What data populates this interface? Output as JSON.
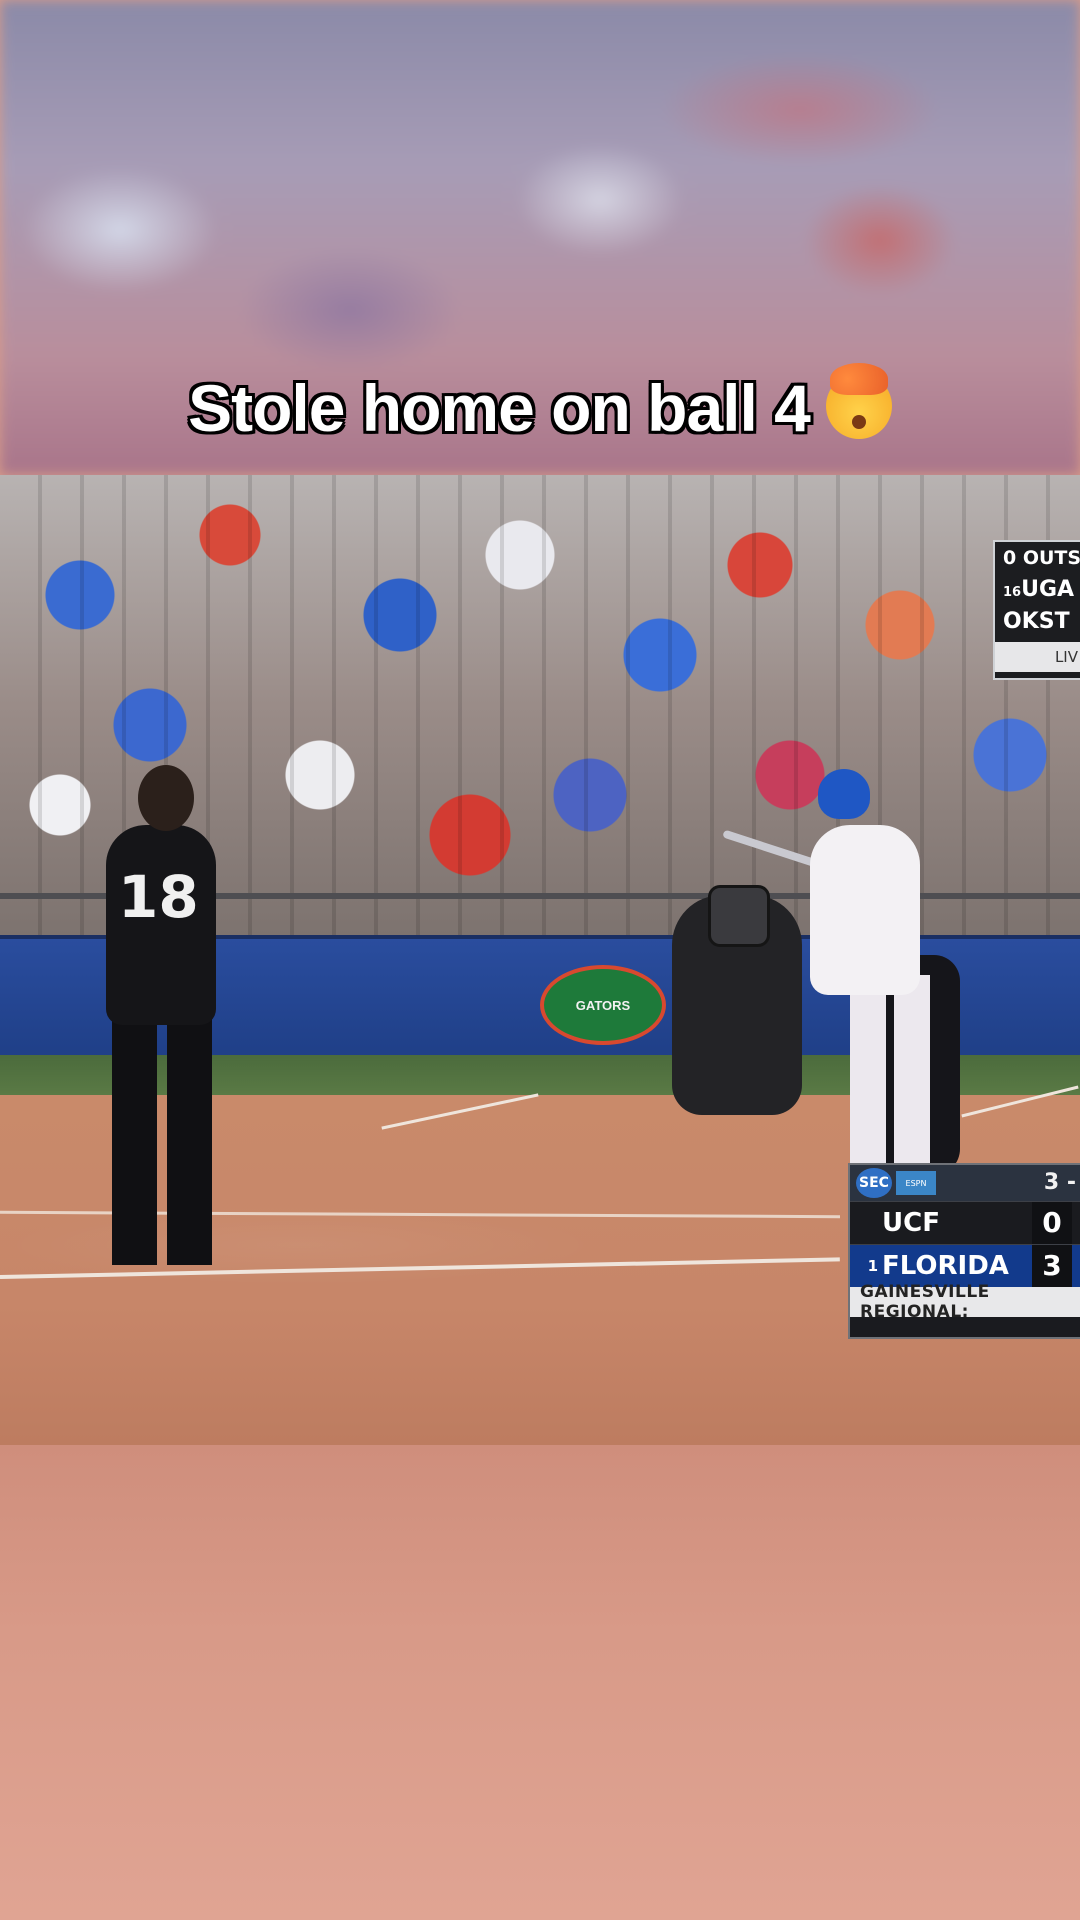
{
  "caption": {
    "text": "Stole home on ball 4",
    "emoji": "exploding-head-emoji"
  },
  "scoreboard": {
    "network_logo": "SEC",
    "network_badge": "ESPN",
    "inning": "3 -",
    "teams": [
      {
        "seed": "",
        "name": "UCF",
        "score": "0"
      },
      {
        "seed": "1",
        "name": "FLORIDA",
        "score": "3"
      }
    ],
    "footer": "GAINESVILLE REGIONAL:"
  },
  "ticker": {
    "outs": "0 OUTS",
    "team1_seed": "16",
    "team1": "UGA",
    "team2": "OKST",
    "status": "LIV"
  },
  "field": {
    "wall_logo_text": "GATORS",
    "pitcher_number": "18"
  },
  "colors": {
    "home_team": "#123a8c",
    "wall": "#2a4d9e",
    "dirt": "#c98a6a"
  }
}
